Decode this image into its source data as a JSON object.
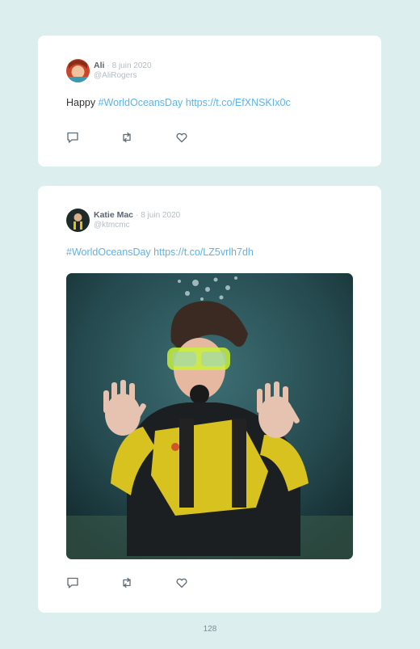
{
  "tweets": [
    {
      "name": "Ali",
      "date": "8 juin 2020",
      "handle": "@AliRogers",
      "text_prefix": "Happy ",
      "hashtag": "#WorldOceansDay",
      "link": "https://t.co/EfXNSKIx0c"
    },
    {
      "name": "Katie Mac",
      "date": "8 juin 2020",
      "handle": "@ktmcmc",
      "text_prefix": "",
      "hashtag": "#WorldOceansDay",
      "link": "https://t.co/LZ5vrlh7dh"
    }
  ],
  "separator": "·",
  "page_number": "128",
  "icons": [
    "reply-icon",
    "retweet-icon",
    "like-icon"
  ],
  "colors": {
    "background": "#dcefee",
    "link": "#5fb3e6",
    "card": "#ffffff"
  }
}
